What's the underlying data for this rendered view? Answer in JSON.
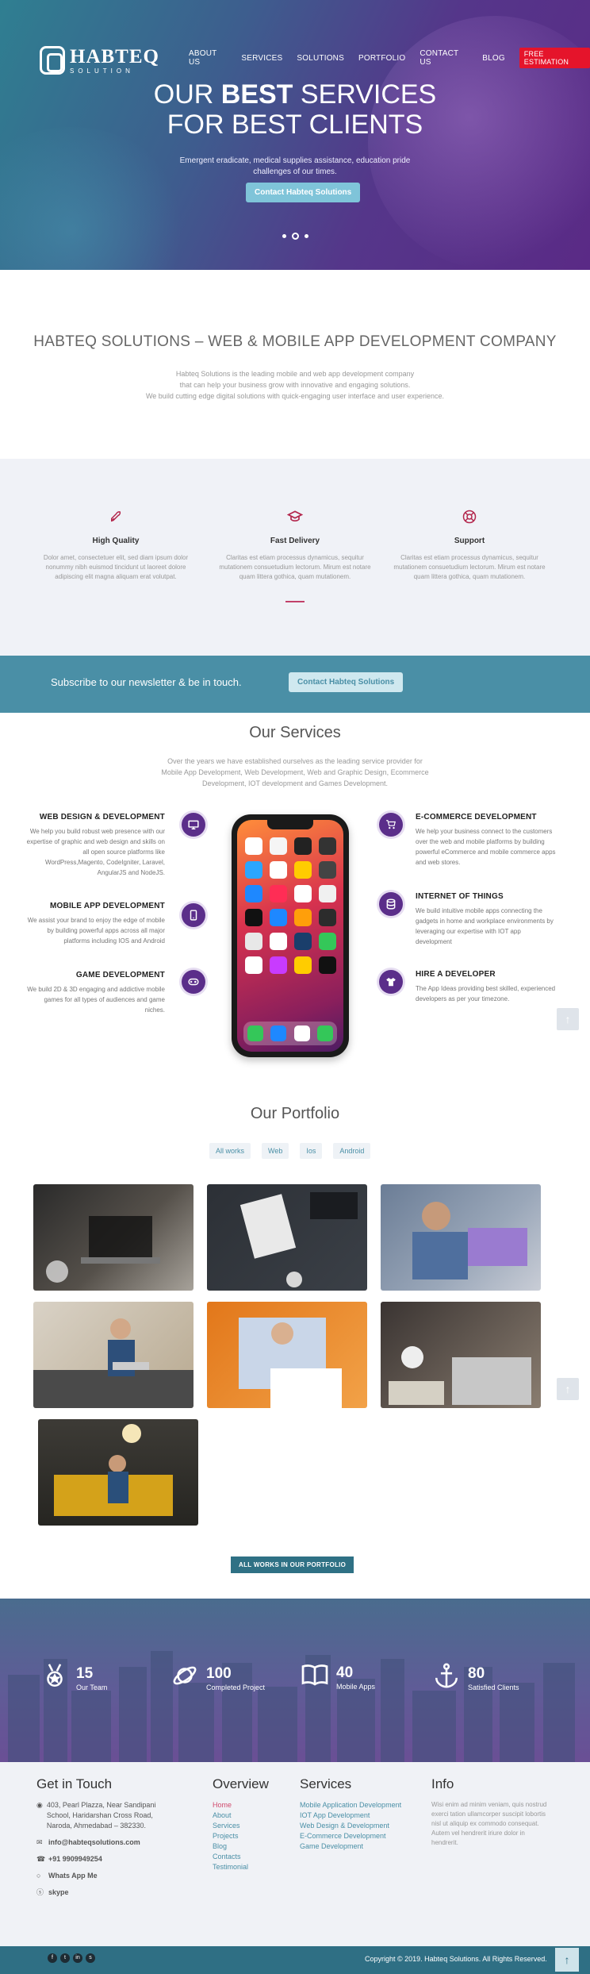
{
  "brand": {
    "name": "HABTEQ",
    "sub": "SOLUTION"
  },
  "nav": {
    "items": [
      "ABOUT US",
      "SERVICES",
      "SOLUTIONS",
      "PORTFOLIO",
      "CONTACT US",
      "BLOG"
    ],
    "cta": "FREE ESTIMATION",
    "cta_color": "#e5142b"
  },
  "hero": {
    "title_pre": "OUR ",
    "title_bold": "BEST",
    "title_post": " SERVICES",
    "title_line2": "FOR BEST CLIENTS",
    "subtitle": "Emergent eradicate, medical supplies assistance, education pride challenges of our times.",
    "button": "Contact Habteq Solutions"
  },
  "intro": {
    "heading": "HABTEQ SOLUTIONS – WEB & MOBILE APP DEVELOPMENT COMPANY",
    "line1": "Habteq Solutions is the leading mobile and web app development company",
    "line2": "that can help your business grow with innovative and engaging solutions.",
    "line3": "We build cutting edge digital solutions with quick-engaging user interface and user experience."
  },
  "features": [
    {
      "icon": "rocket-icon",
      "title": "High Quality",
      "text": "Dolor amet, consectetuer elit, sed diam ipsum dolor nonummy nibh euismod tincidunt ut laoreet dolore adipiscing elit magna aliquam erat volutpat."
    },
    {
      "icon": "graduation-cap-icon",
      "title": "Fast Delivery",
      "text": "Claritas est etiam processus dynamicus, sequitur mutationem consuetudium lectorum. Mirum est notare quam littera gothica, quam mutationem."
    },
    {
      "icon": "life-ring-icon",
      "title": "Support",
      "text": "Claritas est etiam processus dynamicus, sequitur mutationem consuetudium lectorum. Mirum est notare quam littera gothica, quam mutationem."
    }
  ],
  "newsletter": {
    "text": "Subscribe to our newsletter & be in touch.",
    "button": "Contact Habteq Solutions"
  },
  "services": {
    "heading": "Our Services",
    "intro": "Over the years we have established ourselves as the leading service provider for Mobile App Development, Web Development, Web and Graphic Design, Ecommerce Development, IOT development and Games Development.",
    "items": [
      {
        "icon": "monitor-icon",
        "title": "WEB DESIGN & DEVELOPMENT",
        "text": "We help you build robust web presence with our expertise of graphic and web design and skills on all open source platforms like WordPress,Magento, CodeIgniter, Laravel, AngularJS and NodeJS."
      },
      {
        "icon": "mobile-icon",
        "title": "MOBILE APP DEVELOPMENT",
        "text": "We assist your brand to enjoy the edge of mobile by building powerful apps across all major platforms including IOS and Android"
      },
      {
        "icon": "gamepad-icon",
        "title": "GAME DEVELOPMENT",
        "text": "We build 2D & 3D engaging and addictive mobile games for all types of audiences and game niches."
      },
      {
        "icon": "cart-icon",
        "title": "E-COMMERCE DEVELOPMENT",
        "text": "We help your business connect to the customers over the web and mobile platforms by building powerful eCommerce and mobile commerce apps and web stores."
      },
      {
        "icon": "database-icon",
        "title": "INTERNET OF THINGS",
        "text": "We build intuitive mobile apps connecting the gadgets in home and workplace environments by leveraging our expertise with IOT app development"
      },
      {
        "icon": "tshirt-icon",
        "title": "HIRE A DEVELOPER",
        "text": "The App Ideas providing best skilled, experienced developers as per your timezone."
      }
    ]
  },
  "portfolio": {
    "heading": "Our Portfolio",
    "filters": [
      "All works",
      "Web",
      "Ios",
      "Android"
    ],
    "all_button": "ALL WORKS IN OUR PORTFOLIO"
  },
  "stats": [
    {
      "icon": "medal-icon",
      "value": "15",
      "label": "Our Team"
    },
    {
      "icon": "planet-icon",
      "value": "100",
      "label": "Completed Project"
    },
    {
      "icon": "book-icon",
      "value": "40",
      "label": "Mobile Apps"
    },
    {
      "icon": "anchor-icon",
      "value": "80",
      "label": "Satisfied Clients"
    }
  ],
  "footer": {
    "contact": {
      "heading": "Get in Touch",
      "address": "403, Pearl Plazza, Near Sandipani School, Haridarshan Cross Road, Naroda, Ahmedabad – 382330.",
      "email": "info@habteqsolutions.com",
      "phone": "+91 9909949254",
      "whatsapp": "Whats App Me",
      "skype": "skype"
    },
    "overview": {
      "heading": "Overview",
      "links": [
        "Home",
        "About",
        "Services",
        "Projects",
        "Blog",
        "Contacts",
        "Testimonial"
      ]
    },
    "services": {
      "heading": "Services",
      "links": [
        "Mobile Application Development",
        "IOT App Development",
        "Web Design & Development",
        "E-Commerce Development",
        "Game Development"
      ]
    },
    "info": {
      "heading": "Info",
      "text": "Wisi enim ad minim veniam, quis nostrud exerci tation ullamcorper suscipit lobortis nisl ut aliquip ex commodo consequat. Autem vel hendrerit iriure dolor in hendrerit."
    },
    "copyright": "Copyright © 2019. Habteq Solutions. All Rights Reserved."
  }
}
